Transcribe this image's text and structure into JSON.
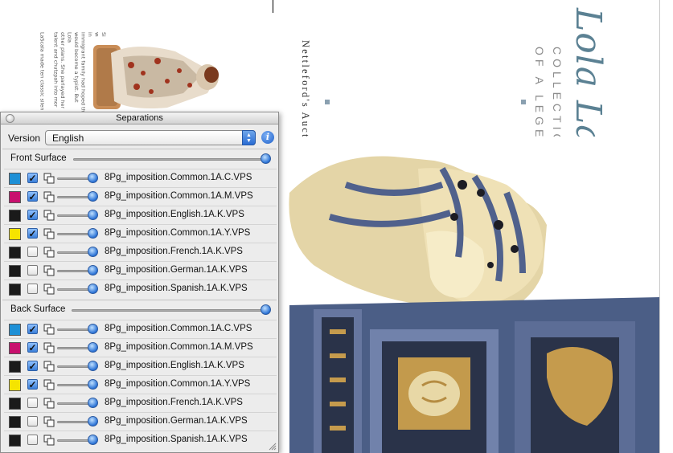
{
  "spread": {
    "auction_text": "Nettleford's Auction",
    "collections_lines": [
      "COLLECTIONS",
      "OF A LEGEND"
    ],
    "brand_logo": "Lola LaScala",
    "body_text_lines": [
      "Silent film siren Lola LaScala was",
      "in Illogi in Hoboken, New Jers",
      "immigrant family had hoped th",
      "would become a typist. But Lola",
      "other plans. She parlayed her",
      "talent and chutzpah into mor",
      "",
      "LaScala made ten classic silen"
    ]
  },
  "palette": {
    "title": "Separations",
    "version_label": "Version",
    "version_value": "English",
    "info_icon": "info-icon",
    "surfaces": [
      {
        "label": "Front Surface",
        "level": 1.0,
        "rows": [
          {
            "color": "#1e90d6",
            "checked": true,
            "name": "8Pg_imposition.Common.1A.C.VPS"
          },
          {
            "color": "#c8106e",
            "checked": true,
            "name": "8Pg_imposition.Common.1A.M.VPS"
          },
          {
            "color": "#1a1a1a",
            "checked": true,
            "name": "8Pg_imposition.English.1A.K.VPS"
          },
          {
            "color": "#f5e400",
            "checked": true,
            "name": "8Pg_imposition.Common.1A.Y.VPS"
          },
          {
            "color": "#1a1a1a",
            "checked": false,
            "name": "8Pg_imposition.French.1A.K.VPS"
          },
          {
            "color": "#1a1a1a",
            "checked": false,
            "name": "8Pg_imposition.German.1A.K.VPS"
          },
          {
            "color": "#1a1a1a",
            "checked": false,
            "name": "8Pg_imposition.Spanish.1A.K.VPS"
          }
        ]
      },
      {
        "label": "Back Surface",
        "level": 1.0,
        "rows": [
          {
            "color": "#1e90d6",
            "checked": true,
            "name": "8Pg_imposition.Common.1A.C.VPS"
          },
          {
            "color": "#c8106e",
            "checked": true,
            "name": "8Pg_imposition.Common.1A.M.VPS"
          },
          {
            "color": "#1a1a1a",
            "checked": true,
            "name": "8Pg_imposition.English.1A.K.VPS"
          },
          {
            "color": "#f5e400",
            "checked": true,
            "name": "8Pg_imposition.Common.1A.Y.VPS"
          },
          {
            "color": "#1a1a1a",
            "checked": false,
            "name": "8Pg_imposition.French.1A.K.VPS"
          },
          {
            "color": "#1a1a1a",
            "checked": false,
            "name": "8Pg_imposition.German.1A.K.VPS"
          },
          {
            "color": "#1a1a1a",
            "checked": false,
            "name": "8Pg_imposition.Spanish.1A.K.VPS"
          }
        ]
      }
    ]
  }
}
